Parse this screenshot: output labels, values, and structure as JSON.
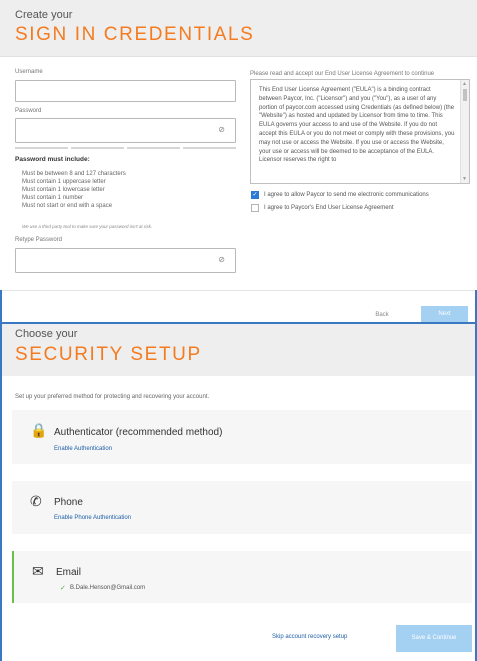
{
  "credentials": {
    "subtitle": "Create your",
    "title": "SIGN IN CREDENTIALS",
    "username_label": "Username",
    "password_label": "Password",
    "retype_label": "Retype Password",
    "requirements": {
      "title": "Password must include:",
      "items": [
        "Must be between 8 and 127 characters",
        "Must contain 1 uppercase letter",
        "Must contain 1 lowercase letter",
        "Must contain 1 number",
        "Must not start or end with a space"
      ],
      "note": "We use a third party tool to make sure your password isn't at risk."
    },
    "eula": {
      "label": "Please read and accept our End User License Agreement to continue",
      "text": "This End User License Agreement (\"EULA\") is a binding contract between Paycor, Inc. (\"Licensor\") and you (\"You\"), as a user of any portion of paycor.com accessed using Credentials (as defined below) (the \"Website\") as hosted and updated by Licensor from time to time. This EULA governs your access to and use of the Website. If you do not accept this EULA or you do not meet or comply with these provisions, you may not use or access the Website. If you use or access the Website, your use or access will be deemed to be acceptance of the EULA. Licensor reserves the right to"
    },
    "checkboxes": {
      "communications": "I agree to allow Paycor to send me electronic communications",
      "eula_agree": "I agree to Paycor's End User License Agreement"
    },
    "buttons": {
      "back": "Back",
      "next": "Next"
    }
  },
  "security": {
    "subtitle": "Choose your",
    "title": "SECURITY SETUP",
    "intro": "Set up your preferred method for protecting and recovering your account.",
    "methods": {
      "authenticator": {
        "title": "Authenticator (recommended method)",
        "link": "Enable Authentication"
      },
      "phone": {
        "title": "Phone",
        "link": "Enable Phone Authentication"
      },
      "email": {
        "title": "Email",
        "value": "B.Dale.Henson@Gmail.com"
      }
    },
    "buttons": {
      "skip": "Skip account recovery setup",
      "save": "Save & Continue"
    }
  },
  "colors": {
    "accent_orange": "#f47b20",
    "link_blue": "#1f5fa8",
    "button_blue_disabled": "#a4d0f2",
    "success_green": "#4caf3c"
  }
}
